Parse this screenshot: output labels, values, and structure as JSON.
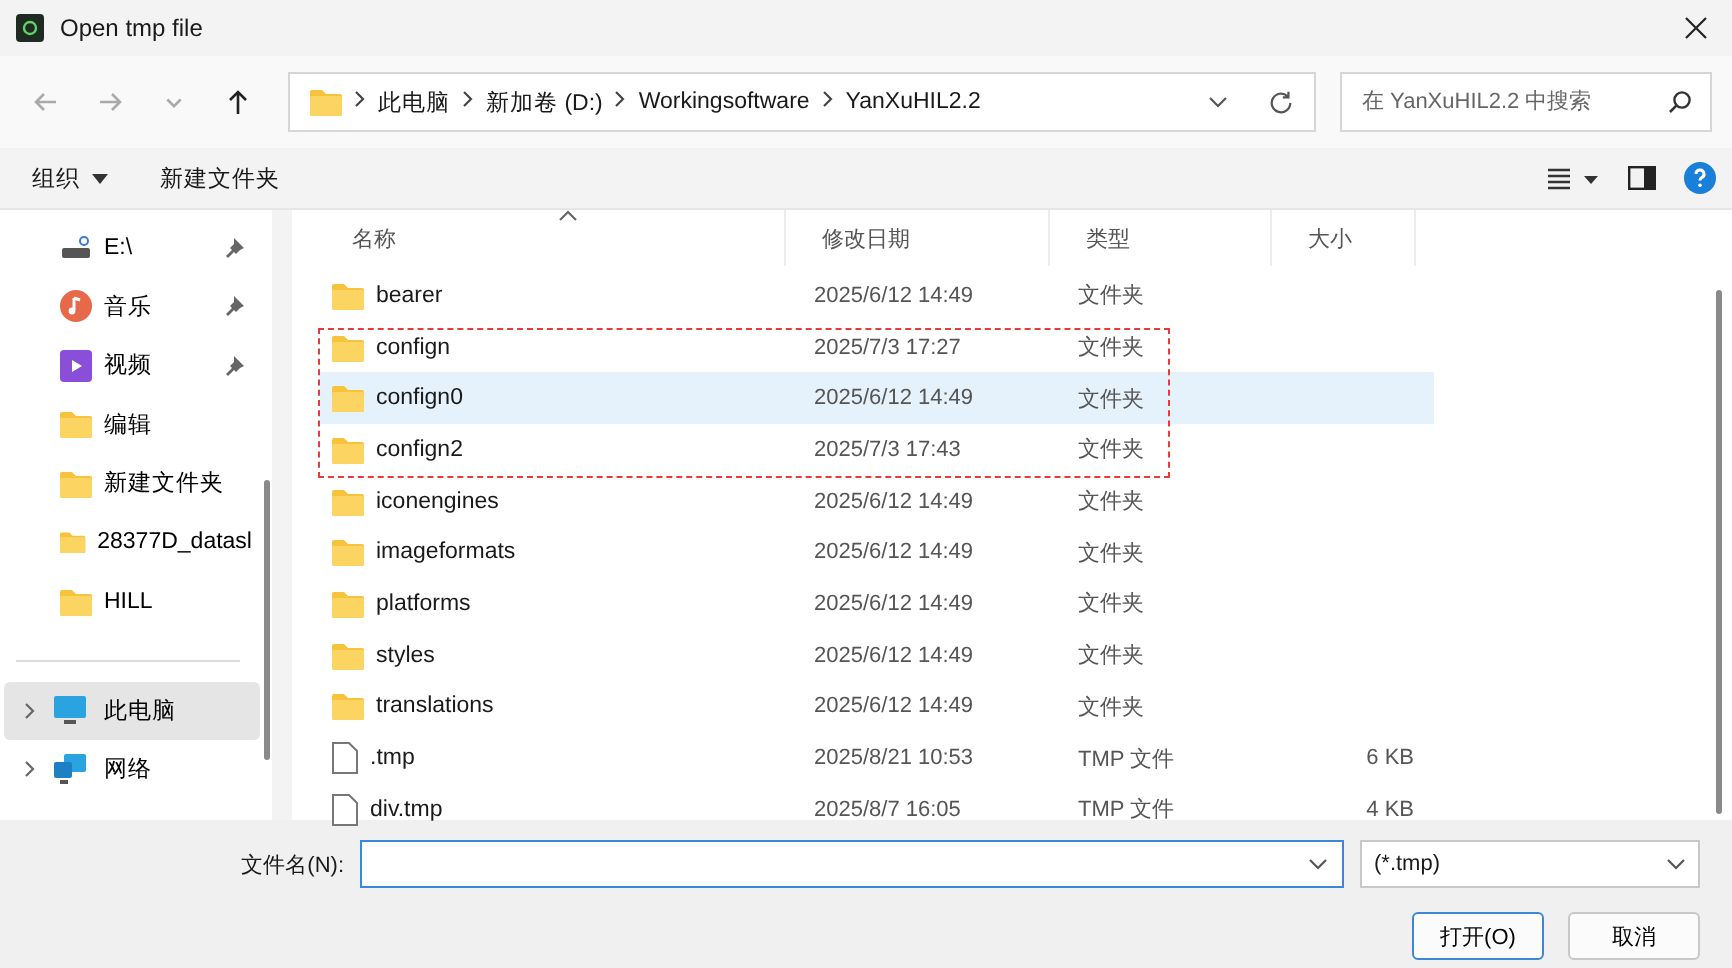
{
  "window": {
    "title": "Open tmp file"
  },
  "nav": {
    "buttons": [
      {
        "kind": "back",
        "disabled": true
      },
      {
        "kind": "forward",
        "disabled": true
      },
      {
        "kind": "recent",
        "disabled": true
      },
      {
        "kind": "up",
        "disabled": false
      }
    ],
    "breadcrumbs": [
      "此电脑",
      "新加卷 (D:)",
      "Workingsoftware",
      "YanXuHIL2.2"
    ],
    "search": {
      "placeholder": "在 YanXuHIL2.2 中搜索"
    }
  },
  "toolbar": {
    "organize": "组织",
    "new_folder": "新建文件夹"
  },
  "sidebar": {
    "quick": [
      {
        "label": "E:\\",
        "kind": "drive",
        "pinned": true
      },
      {
        "label": "音乐",
        "kind": "music",
        "pinned": true
      },
      {
        "label": "视频",
        "kind": "video",
        "pinned": true
      },
      {
        "label": "编辑",
        "kind": "folder",
        "pinned": false
      },
      {
        "label": "新建文件夹",
        "kind": "folder",
        "pinned": false
      },
      {
        "label": "28377D_datasl",
        "kind": "folder",
        "pinned": false
      },
      {
        "label": "HILL",
        "kind": "folder",
        "pinned": false
      }
    ],
    "roots": [
      {
        "label": "此电脑",
        "kind": "pc",
        "selected": true
      },
      {
        "label": "网络",
        "kind": "network",
        "selected": false
      }
    ]
  },
  "table": {
    "columns": [
      "名称",
      "修改日期",
      "类型",
      "大小"
    ],
    "rows": [
      {
        "name": "bearer",
        "date": "2025/6/12 14:49",
        "type": "文件夹",
        "kind": "folder",
        "selected": false
      },
      {
        "name": "confign",
        "date": "2025/7/3 17:27",
        "type": "文件夹",
        "kind": "folder",
        "selected": false
      },
      {
        "name": "confign0",
        "date": "2025/6/12 14:49",
        "type": "文件夹",
        "kind": "folder",
        "selected": true
      },
      {
        "name": "confign2",
        "date": "2025/7/3 17:43",
        "type": "文件夹",
        "kind": "folder",
        "selected": false
      },
      {
        "name": "iconengines",
        "date": "2025/6/12 14:49",
        "type": "文件夹",
        "kind": "folder",
        "selected": false
      },
      {
        "name": "imageformats",
        "date": "2025/6/12 14:49",
        "type": "文件夹",
        "kind": "folder",
        "selected": false
      },
      {
        "name": "platforms",
        "date": "2025/6/12 14:49",
        "type": "文件夹",
        "kind": "folder",
        "selected": false
      },
      {
        "name": "styles",
        "date": "2025/6/12 14:49",
        "type": "文件夹",
        "kind": "folder",
        "selected": false
      },
      {
        "name": "translations",
        "date": "2025/6/12 14:49",
        "type": "文件夹",
        "kind": "folder",
        "selected": false
      },
      {
        "name": ".tmp",
        "date": "2025/8/21 10:53",
        "type": "TMP 文件",
        "size": "6 KB",
        "kind": "file",
        "selected": false
      },
      {
        "name": "div.tmp",
        "date": "2025/8/7 16:05",
        "type": "TMP 文件",
        "size": "4 KB",
        "kind": "file",
        "selected": false
      }
    ]
  },
  "bottom": {
    "filename_label": "文件名(N):",
    "filter": "(*.tmp)",
    "open": "打开(O)",
    "cancel": "取消"
  }
}
